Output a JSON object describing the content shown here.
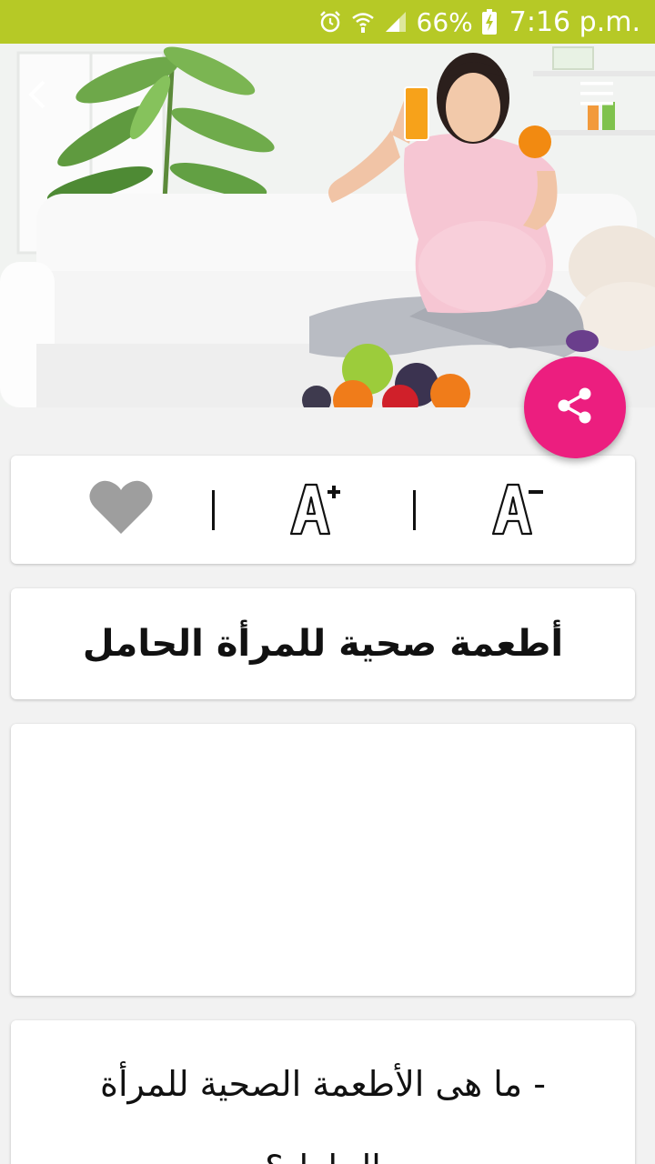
{
  "status_bar": {
    "battery_percent": "66%",
    "time": "7:16 p.m.",
    "icons": [
      "alarm-icon",
      "wifi-icon",
      "signal-icon",
      "battery-charging-icon"
    ]
  },
  "hero": {
    "image": "pregnant-woman-with-fruit-photo",
    "back_icon": "back-arrow-icon",
    "menu_icon": "hamburger-menu-icon"
  },
  "share_button": {
    "icon": "share-icon",
    "color": "#ec1e7f"
  },
  "toolbar": {
    "favorite_icon": "heart-icon",
    "font_increase_icon": "font-increase-icon",
    "font_decrease_icon": "font-decrease-icon"
  },
  "article": {
    "title": "أطعمة صحية للمرأة الحامل",
    "body": "- ما هى الأطعمة الصحية للمرأة الحامل؟"
  },
  "colors": {
    "status_bar": "#b6c926",
    "accent": "#ec1e7f",
    "background": "#f2f2f2"
  }
}
